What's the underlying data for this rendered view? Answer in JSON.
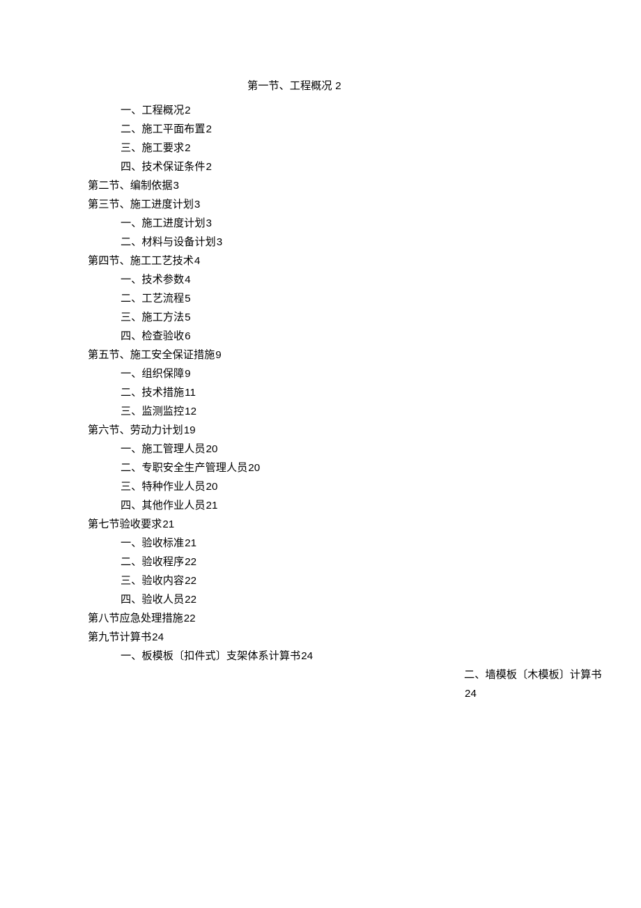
{
  "toc": {
    "title": {
      "text": "第一节、工程概况",
      "page": "2"
    },
    "lines": [
      {
        "cls": "sub",
        "text": "一、工程概况",
        "page": "2"
      },
      {
        "cls": "sub",
        "text": "二、施工平面布置",
        "page": "2"
      },
      {
        "cls": "sub",
        "text": "三、施工要求",
        "page": "2"
      },
      {
        "cls": "sub",
        "text": "四、技术保证条件",
        "page": "2"
      },
      {
        "cls": "section",
        "text": "第二节、编制依据",
        "page": "3"
      },
      {
        "cls": "section",
        "text": "第三节、施工进度计划",
        "page": "3"
      },
      {
        "cls": "sub",
        "text": "一、施工进度计划",
        "page": "3"
      },
      {
        "cls": "sub",
        "text": "二、材料与设备计划",
        "page": "3"
      },
      {
        "cls": "section",
        "text": "第四节、施工工艺技术",
        "page": "4"
      },
      {
        "cls": "sub",
        "text": "一、技术参数",
        "page": "4"
      },
      {
        "cls": "sub",
        "text": "二、工艺流程",
        "page": "5"
      },
      {
        "cls": "sub",
        "text": "三、施工方法",
        "page": "5"
      },
      {
        "cls": "sub",
        "text": "四、检查验收",
        "page": "6"
      },
      {
        "cls": "section",
        "text": "第五节、施工安全保证措施",
        "page": "9"
      },
      {
        "cls": "sub",
        "text": "一、组织保障",
        "page": "9"
      },
      {
        "cls": "sub",
        "text": "二、技术措施",
        "page": "11"
      },
      {
        "cls": "sub",
        "text": "三、监测监控",
        "page": "12"
      },
      {
        "cls": "section",
        "text": "第六节、劳动力计划",
        "page": "19"
      },
      {
        "cls": "sub",
        "text": "一、施工管理人员",
        "page": "20"
      },
      {
        "cls": "sub",
        "text": "二、专职安全生产管理人员",
        "page": "20"
      },
      {
        "cls": "sub",
        "text": "三、特种作业人员",
        "page": "20"
      },
      {
        "cls": "sub",
        "text": "四、其他作业人员",
        "page": "21"
      },
      {
        "cls": "section",
        "text": "第七节验收要求",
        "page": "21"
      },
      {
        "cls": "sub",
        "text": "一、验收标准",
        "page": "21"
      },
      {
        "cls": "sub",
        "text": "二、验收程序",
        "page": "22"
      },
      {
        "cls": "sub",
        "text": "三、验收内容",
        "page": "22"
      },
      {
        "cls": "sub",
        "text": "四、验收人员",
        "page": "22"
      },
      {
        "cls": "section",
        "text": "第八节应急处理措施",
        "page": "22"
      },
      {
        "cls": "section",
        "text": "第九节计算书",
        "page": "24"
      },
      {
        "cls": "sub",
        "text": "一、板模板〔扣件式〕支架体系计算书",
        "page": "24"
      },
      {
        "cls": "item-9-2",
        "text": "二、墙模板〔木模板〕计算书",
        "page": "24"
      }
    ]
  }
}
